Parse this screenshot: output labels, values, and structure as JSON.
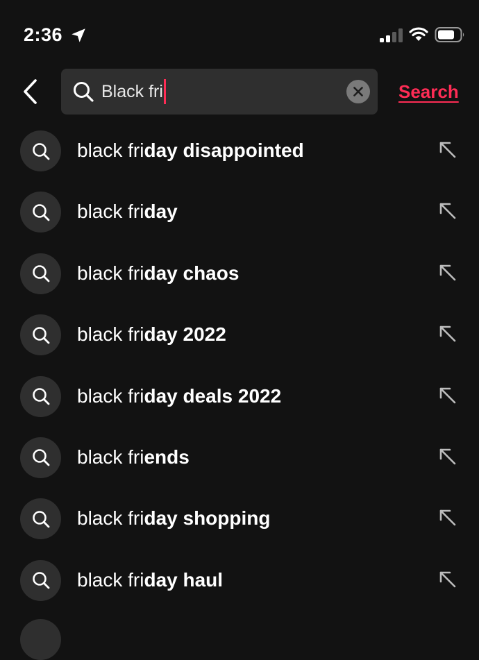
{
  "status_bar": {
    "time": "2:36"
  },
  "search": {
    "query": "Black fri",
    "submit_label": "Search"
  },
  "colors": {
    "accent": "#fe2c55",
    "background": "#121212",
    "field": "#2f2f2f"
  },
  "suggestions": [
    {
      "typed": "black fri",
      "completion": "day disappointed"
    },
    {
      "typed": "black fri",
      "completion": "day"
    },
    {
      "typed": "black fri",
      "completion": "day chaos"
    },
    {
      "typed": "black fri",
      "completion": "day 2022"
    },
    {
      "typed": "black fri",
      "completion": "day deals 2022"
    },
    {
      "typed": "black fri",
      "completion": "ends"
    },
    {
      "typed": "black fri",
      "completion": "day shopping"
    },
    {
      "typed": "black fri",
      "completion": "day haul"
    }
  ],
  "icons": {
    "back": "chevron-left-icon",
    "search": "search-icon",
    "clear": "clear-icon",
    "fill": "arrow-up-left-icon",
    "location": "location-arrow-icon",
    "signal": "signal-icon",
    "wifi": "wifi-icon",
    "battery": "battery-icon"
  }
}
